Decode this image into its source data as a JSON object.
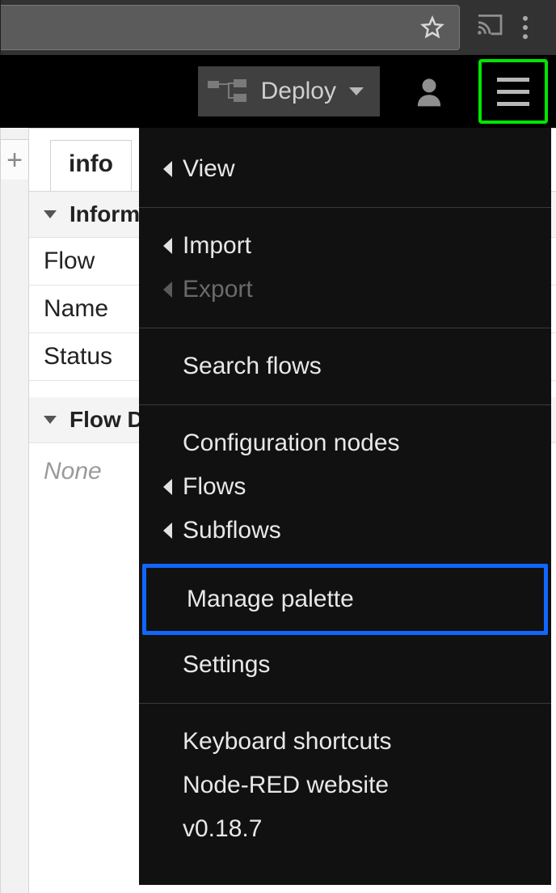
{
  "header": {
    "deploy_label": "Deploy"
  },
  "sidebar": {
    "tab_label": "info",
    "section1_title": "Information",
    "rows": {
      "flow_label": "Flow",
      "name_label": "Name",
      "status_label": "Status"
    },
    "section2_title": "Flow Description",
    "description_value": "None"
  },
  "menu": {
    "view": "View",
    "import": "Import",
    "export": "Export",
    "search": "Search flows",
    "config_nodes": "Configuration nodes",
    "flows": "Flows",
    "subflows": "Subflows",
    "manage_palette": "Manage palette",
    "settings": "Settings",
    "keyboard": "Keyboard shortcuts",
    "website": "Node-RED website",
    "version": "v0.18.7"
  }
}
